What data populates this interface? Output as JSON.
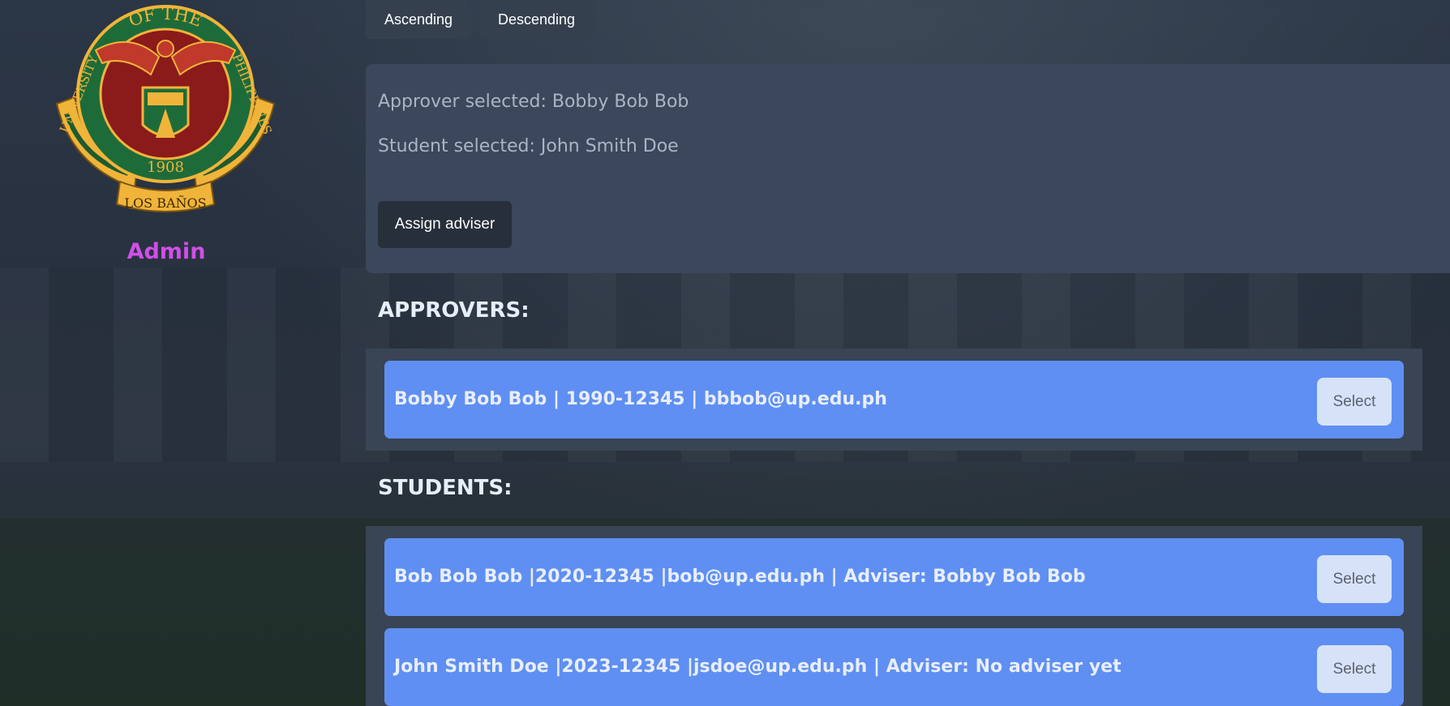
{
  "sidebar": {
    "seal": {
      "top_text": "OF THE",
      "left_text": "UNIVERSITY",
      "right_text": "PHILIPPINES",
      "year": "1908",
      "ribbon": "LOS BAÑOS"
    },
    "role": "Admin",
    "role_color": "#d04fe8"
  },
  "sort": {
    "ascending_label": "Ascending",
    "descending_label": "Descending"
  },
  "selection": {
    "approver_text": "Approver selected: Bobby Bob Bob",
    "student_text": "Student selected: John Smith Doe",
    "assign_label": "Assign adviser"
  },
  "approvers": {
    "title": "APPROVERS:",
    "items": [
      {
        "text": "Bobby Bob Bob | 1990-12345 | bbbob@up.edu.ph",
        "select_label": "Select"
      }
    ]
  },
  "students": {
    "title": "STUDENTS:",
    "items": [
      {
        "text": "Bob Bob Bob |2020-12345 |bob@up.edu.ph | Adviser: Bobby Bob Bob",
        "select_label": "Select"
      },
      {
        "text": "John Smith Doe |2023-12345 |jsdoe@up.edu.ph | Adviser: No adviser yet",
        "select_label": "Select"
      }
    ]
  },
  "colors": {
    "card_bg": "#5f8ff2",
    "panel_bg": "#3b475a",
    "seal_green": "#1e6b3a",
    "seal_maroon": "#8b1a1a",
    "seal_gold": "#f0b43a"
  }
}
